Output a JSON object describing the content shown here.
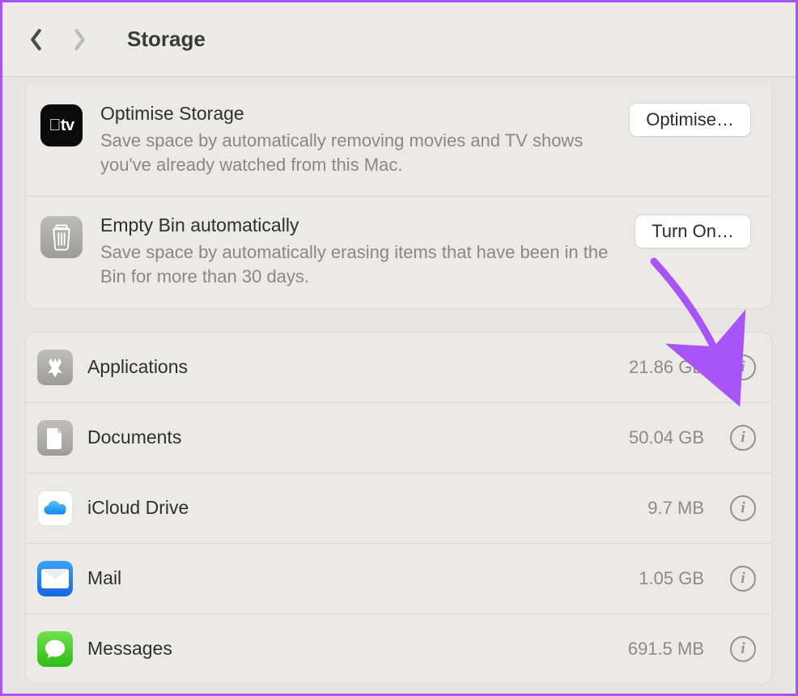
{
  "header": {
    "title": "Storage"
  },
  "recommendations": {
    "optimise": {
      "title": "Optimise Storage",
      "desc": "Save space by automatically removing movies and TV shows you've already watched from this Mac.",
      "button": "Optimise…"
    },
    "emptyBin": {
      "title": "Empty Bin automatically",
      "desc": "Save space by automatically erasing items that have been in the Bin for more than 30 days.",
      "button": "Turn On…"
    }
  },
  "categories": [
    {
      "key": "applications",
      "label": "Applications",
      "size": "21.86 GB"
    },
    {
      "key": "documents",
      "label": "Documents",
      "size": "50.04 GB"
    },
    {
      "key": "icloud",
      "label": "iCloud Drive",
      "size": "9.7 MB"
    },
    {
      "key": "mail",
      "label": "Mail",
      "size": "1.05 GB"
    },
    {
      "key": "messages",
      "label": "Messages",
      "size": "691.5 MB"
    }
  ],
  "annotation": {
    "color": "#a855f7"
  }
}
